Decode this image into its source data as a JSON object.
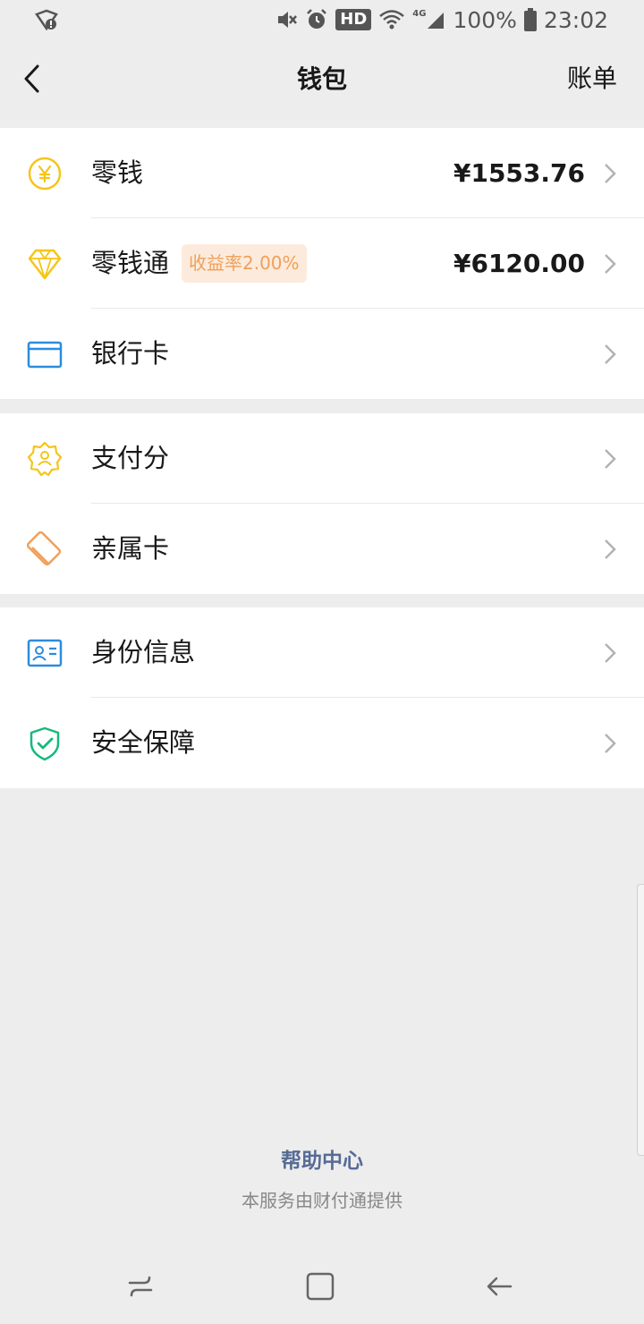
{
  "status_bar": {
    "hd": "HD",
    "network": "4G",
    "battery": "100%",
    "time": "23:02"
  },
  "nav": {
    "title": "钱包",
    "bill": "账单"
  },
  "wallet": {
    "change": {
      "label": "零钱",
      "amount": "¥1553.76"
    },
    "licaitong": {
      "label": "零钱通",
      "badge": "收益率2.00%",
      "amount": "¥6120.00"
    },
    "bank_card": {
      "label": "银行卡"
    }
  },
  "services": {
    "pay_score": {
      "label": "支付分"
    },
    "family_card": {
      "label": "亲属卡"
    }
  },
  "security": {
    "identity": {
      "label": "身份信息"
    },
    "safety": {
      "label": "安全保障"
    }
  },
  "footer": {
    "help": "帮助中心",
    "provider": "本服务由财付通提供"
  },
  "colors": {
    "background": "#ededed",
    "link_blue": "#576b95",
    "icon_yellow": "#f6c516",
    "icon_blue": "#2d8cdc",
    "icon_orange": "#f0a05a",
    "icon_green": "#15ba7a"
  },
  "icons": [
    "shield-status-icon",
    "mute-icon",
    "alarm-icon",
    "wifi-icon",
    "signal-icon",
    "battery-icon",
    "back-arrow-icon",
    "yen-coin-icon",
    "diamond-icon",
    "bank-card-icon",
    "badge-user-icon",
    "family-card-icon",
    "id-card-icon",
    "shield-check-icon",
    "chevron-right-icon",
    "recent-apps-icon",
    "home-icon",
    "back-icon"
  ]
}
